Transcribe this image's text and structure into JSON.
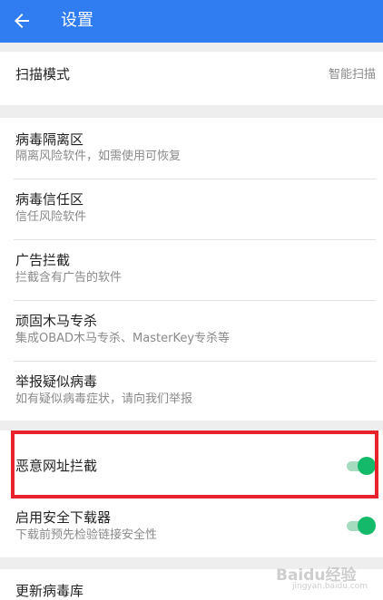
{
  "header": {
    "title": "设置"
  },
  "scan_mode": {
    "label": "扫描模式",
    "value": "智能扫描"
  },
  "items": [
    {
      "label": "病毒隔离区",
      "sub": "隔离风险软件，如需使用可恢复"
    },
    {
      "label": "病毒信任区",
      "sub": "信任风险软件"
    },
    {
      "label": "广告拦截",
      "sub": "拦截含有广告的软件"
    },
    {
      "label": "顽固木马专杀",
      "sub": "集成OBAD木马专杀、MasterKey专杀等"
    },
    {
      "label": "举报疑似病毒",
      "sub": "如有疑似病毒症状，请向我们举报"
    }
  ],
  "toggles": [
    {
      "label": "恶意网址拦截",
      "on": true
    },
    {
      "label": "启用安全下载器",
      "sub": "下载前预先检验链接安全性",
      "on": true
    }
  ],
  "update": {
    "label": "更新病毒库"
  },
  "watermark": {
    "text": "Baidu经验",
    "sub": "jingyan.baidu.com"
  },
  "colors": {
    "appbar": "#2f7df0",
    "toggle_on": "#14b969",
    "highlight": "#e8232d"
  }
}
